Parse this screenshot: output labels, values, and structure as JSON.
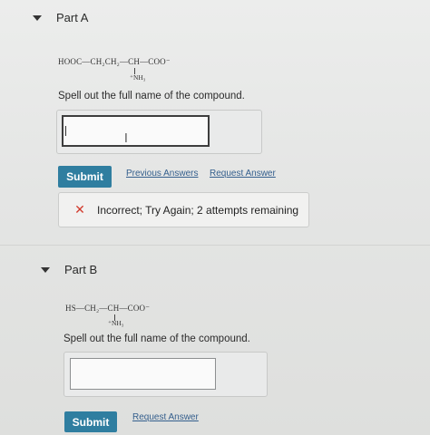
{
  "partA": {
    "title": "Part A",
    "formula": {
      "main": "HOOC—CH₂CH₂—CH—COO⁻",
      "sub": "⁺NH₃"
    },
    "prompt": "Spell out the full name of the compound.",
    "input_value": "",
    "submit_label": "Submit",
    "previous_answers_label": "Previous Answers",
    "request_answer_label": "Request Answer",
    "feedback": {
      "text": "Incorrect; Try Again; 2 attempts remaining",
      "icon": "x-icon",
      "color": "#d23b2d"
    }
  },
  "partB": {
    "title": "Part B",
    "formula": {
      "main": "HS—CH₂—CH—COO⁻",
      "sub": "⁺NH₃"
    },
    "prompt": "Spell out the full name of the compound.",
    "input_value": "",
    "submit_label": "Submit",
    "request_answer_label": "Request Answer"
  },
  "colors": {
    "submit_button": "#2f7ea0",
    "link": "#345f8d"
  }
}
